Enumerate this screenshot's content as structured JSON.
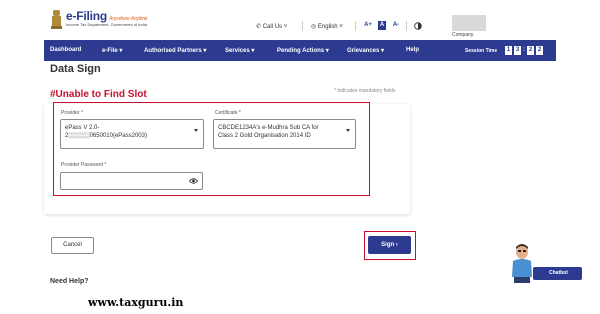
{
  "header": {
    "brand_name": "e-Filing",
    "brand_tagline": "Anywhere Anytime",
    "dept_line1": "Income Tax Department, Government of India",
    "call_us": "Call Us",
    "language": "English",
    "font_large": "A+",
    "font_normal": "A",
    "font_small": "A-",
    "company_label": "Company"
  },
  "nav": {
    "items": [
      {
        "label": "Dashboard"
      },
      {
        "label": "e-File ▾"
      },
      {
        "label": "Authorised Partners ▾"
      },
      {
        "label": "Services ▾"
      },
      {
        "label": "Pending Actions ▾"
      },
      {
        "label": "Grievances ▾"
      },
      {
        "label": "Help"
      }
    ],
    "session_label": "Session Time",
    "timer": [
      "1",
      "3",
      "2",
      "2"
    ]
  },
  "page": {
    "title": "Data Sign",
    "annotation": "#Unable to Find Slot",
    "mandatory_note": "* Indicates mandatory fields"
  },
  "form": {
    "provider_label": "Provider *",
    "provider_value_line1": "ePass V 2.0-",
    "provider_value_line2": "2░░░░░0650010(ePass2003)",
    "certificate_label": "Certificate *",
    "certificate_value_line1": "CBCDE1234A's e-Mudhra Sub CA for",
    "certificate_value_line2": "Class 2 Gold Organisation 2014 ID",
    "password_label": "Provider Password *",
    "password_value": ""
  },
  "actions": {
    "cancel_label": "Cancel",
    "sign_label": "Sign ›"
  },
  "footer": {
    "need_help": "Need Help?",
    "chatbot_label": "Chatbot",
    "watermark": "www.taxguru.in"
  },
  "colors": {
    "primary_navy": "#2c3b8f",
    "highlight_red": "#c8102e",
    "brand_orange": "#e56b1f"
  }
}
